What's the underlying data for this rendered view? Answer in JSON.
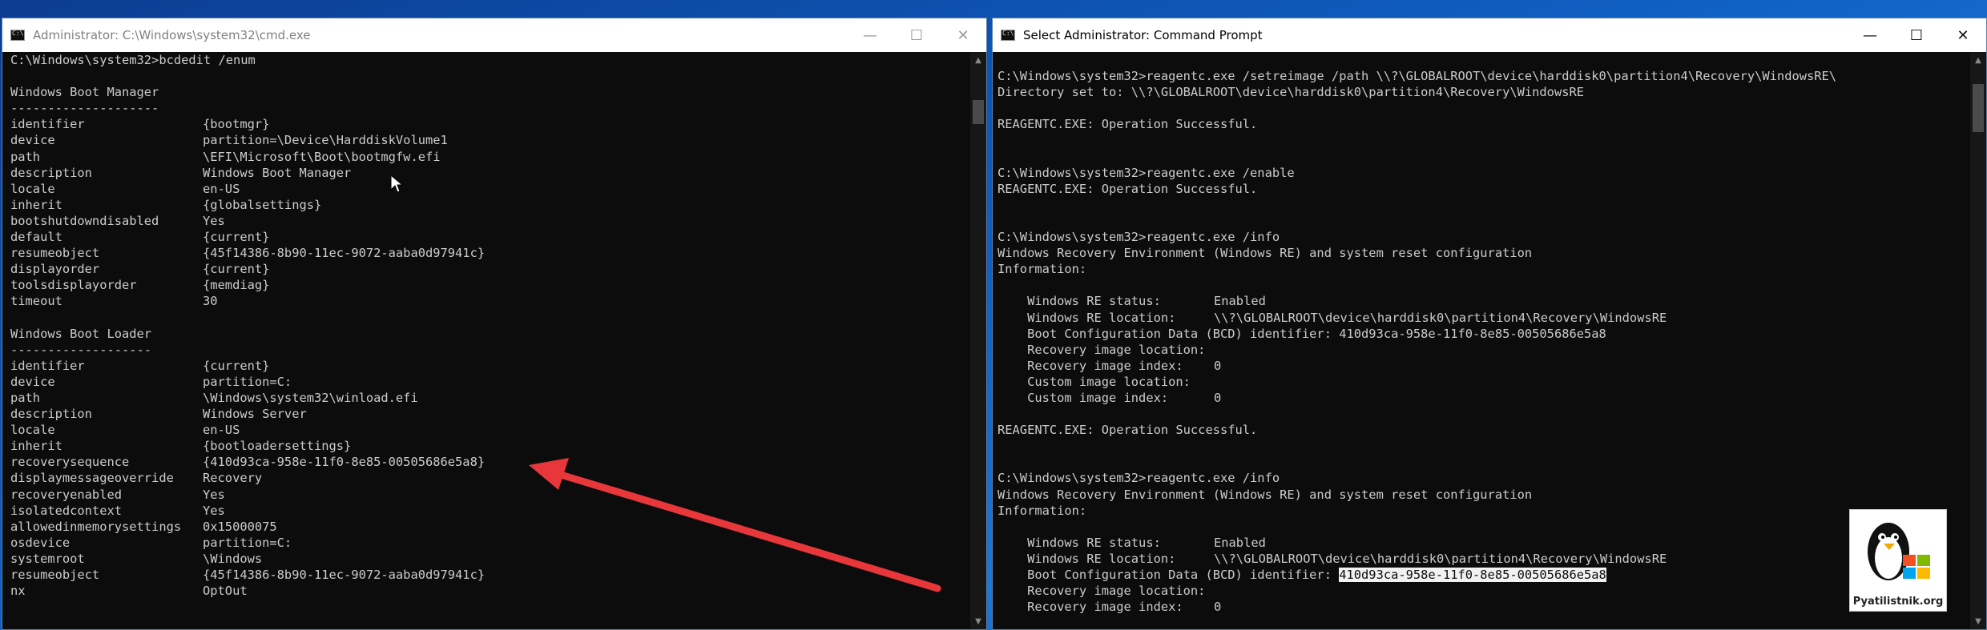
{
  "colors": {
    "console_bg": "#0c0c0c",
    "console_fg": "#cccccc",
    "highlight_bg": "#f2f2f2",
    "arrow": "#e8373b"
  },
  "left_window": {
    "title": "Administrator: C:\\Windows\\system32\\cmd.exe",
    "lines": [
      {
        "t": "C:\\Windows\\system32>bcdedit /enum"
      },
      {
        "t": ""
      },
      {
        "t": "Windows Boot Manager"
      },
      {
        "t": "--------------------"
      },
      {
        "k": "identifier",
        "v": "{bootmgr}"
      },
      {
        "k": "device",
        "v": "partition=\\Device\\HarddiskVolume1"
      },
      {
        "k": "path",
        "v": "\\EFI\\Microsoft\\Boot\\bootmgfw.efi"
      },
      {
        "k": "description",
        "v": "Windows Boot Manager"
      },
      {
        "k": "locale",
        "v": "en-US"
      },
      {
        "k": "inherit",
        "v": "{globalsettings}"
      },
      {
        "k": "bootshutdowndisabled",
        "v": "Yes"
      },
      {
        "k": "default",
        "v": "{current}"
      },
      {
        "k": "resumeobject",
        "v": "{45f14386-8b90-11ec-9072-aaba0d97941c}"
      },
      {
        "k": "displayorder",
        "v": "{current}"
      },
      {
        "k": "toolsdisplayorder",
        "v": "{memdiag}"
      },
      {
        "k": "timeout",
        "v": "30"
      },
      {
        "t": ""
      },
      {
        "t": "Windows Boot Loader"
      },
      {
        "t": "-------------------"
      },
      {
        "k": "identifier",
        "v": "{current}"
      },
      {
        "k": "device",
        "v": "partition=C:"
      },
      {
        "k": "path",
        "v": "\\Windows\\system32\\winload.efi"
      },
      {
        "k": "description",
        "v": "Windows Server"
      },
      {
        "k": "locale",
        "v": "en-US"
      },
      {
        "k": "inherit",
        "v": "{bootloadersettings}"
      },
      {
        "k": "recoverysequence",
        "v": "{410d93ca-958e-11f0-8e85-00505686e5a8}"
      },
      {
        "k": "displaymessageoverride",
        "v": "Recovery"
      },
      {
        "k": "recoveryenabled",
        "v": "Yes"
      },
      {
        "k": "isolatedcontext",
        "v": "Yes"
      },
      {
        "k": "allowedinmemorysettings",
        "v": "0x15000075"
      },
      {
        "k": "osdevice",
        "v": "partition=C:"
      },
      {
        "k": "systemroot",
        "v": "\\Windows"
      },
      {
        "k": "resumeobject",
        "v": "{45f14386-8b90-11ec-9072-aaba0d97941c}"
      },
      {
        "k": "nx",
        "v": "OptOut"
      }
    ]
  },
  "right_window": {
    "title": "Select Administrator: Command Prompt",
    "lines": [
      {
        "t": ""
      },
      {
        "t": "C:\\Windows\\system32>reagentc.exe /setreimage /path \\\\?\\GLOBALROOT\\device\\harddisk0\\partition4\\Recovery\\WindowsRE\\"
      },
      {
        "t": "Directory set to: \\\\?\\GLOBALROOT\\device\\harddisk0\\partition4\\Recovery\\WindowsRE"
      },
      {
        "t": ""
      },
      {
        "t": "REAGENTC.EXE: Operation Successful."
      },
      {
        "t": ""
      },
      {
        "t": ""
      },
      {
        "t": "C:\\Windows\\system32>reagentc.exe /enable"
      },
      {
        "t": "REAGENTC.EXE: Operation Successful."
      },
      {
        "t": ""
      },
      {
        "t": ""
      },
      {
        "t": "C:\\Windows\\system32>reagentc.exe /info"
      },
      {
        "t": "Windows Recovery Environment (Windows RE) and system reset configuration"
      },
      {
        "t": "Information:"
      },
      {
        "t": ""
      },
      {
        "k": "    Windows RE status:",
        "v": "Enabled"
      },
      {
        "k": "    Windows RE location:",
        "v": "\\\\?\\GLOBALROOT\\device\\harddisk0\\partition4\\Recovery\\WindowsRE"
      },
      {
        "t": "    Boot Configuration Data (BCD) identifier: 410d93ca-958e-11f0-8e85-00505686e5a8"
      },
      {
        "k": "    Recovery image location:",
        "v": ""
      },
      {
        "k": "    Recovery image index:",
        "v": "0"
      },
      {
        "k": "    Custom image location:",
        "v": ""
      },
      {
        "k": "    Custom image index:",
        "v": "0"
      },
      {
        "t": ""
      },
      {
        "t": "REAGENTC.EXE: Operation Successful."
      },
      {
        "t": ""
      },
      {
        "t": ""
      },
      {
        "t": "C:\\Windows\\system32>reagentc.exe /info"
      },
      {
        "t": "Windows Recovery Environment (Windows RE) and system reset configuration"
      },
      {
        "t": "Information:"
      },
      {
        "t": ""
      },
      {
        "k": "    Windows RE status:",
        "v": "Enabled"
      },
      {
        "k": "    Windows RE location:",
        "v": "\\\\?\\GLOBALROOT\\device\\harddisk0\\partition4\\Recovery\\WindowsRE"
      },
      {
        "t": "    Boot Configuration Data (BCD) identifier: ",
        "hl": "410d93ca-958e-11f0-8e85-00505686e5a8"
      },
      {
        "k": "    Recovery image location:",
        "v": ""
      },
      {
        "k": "    Recovery image index:",
        "v": "0"
      }
    ]
  },
  "watermark": {
    "text": "Pyatilistnik.org"
  }
}
